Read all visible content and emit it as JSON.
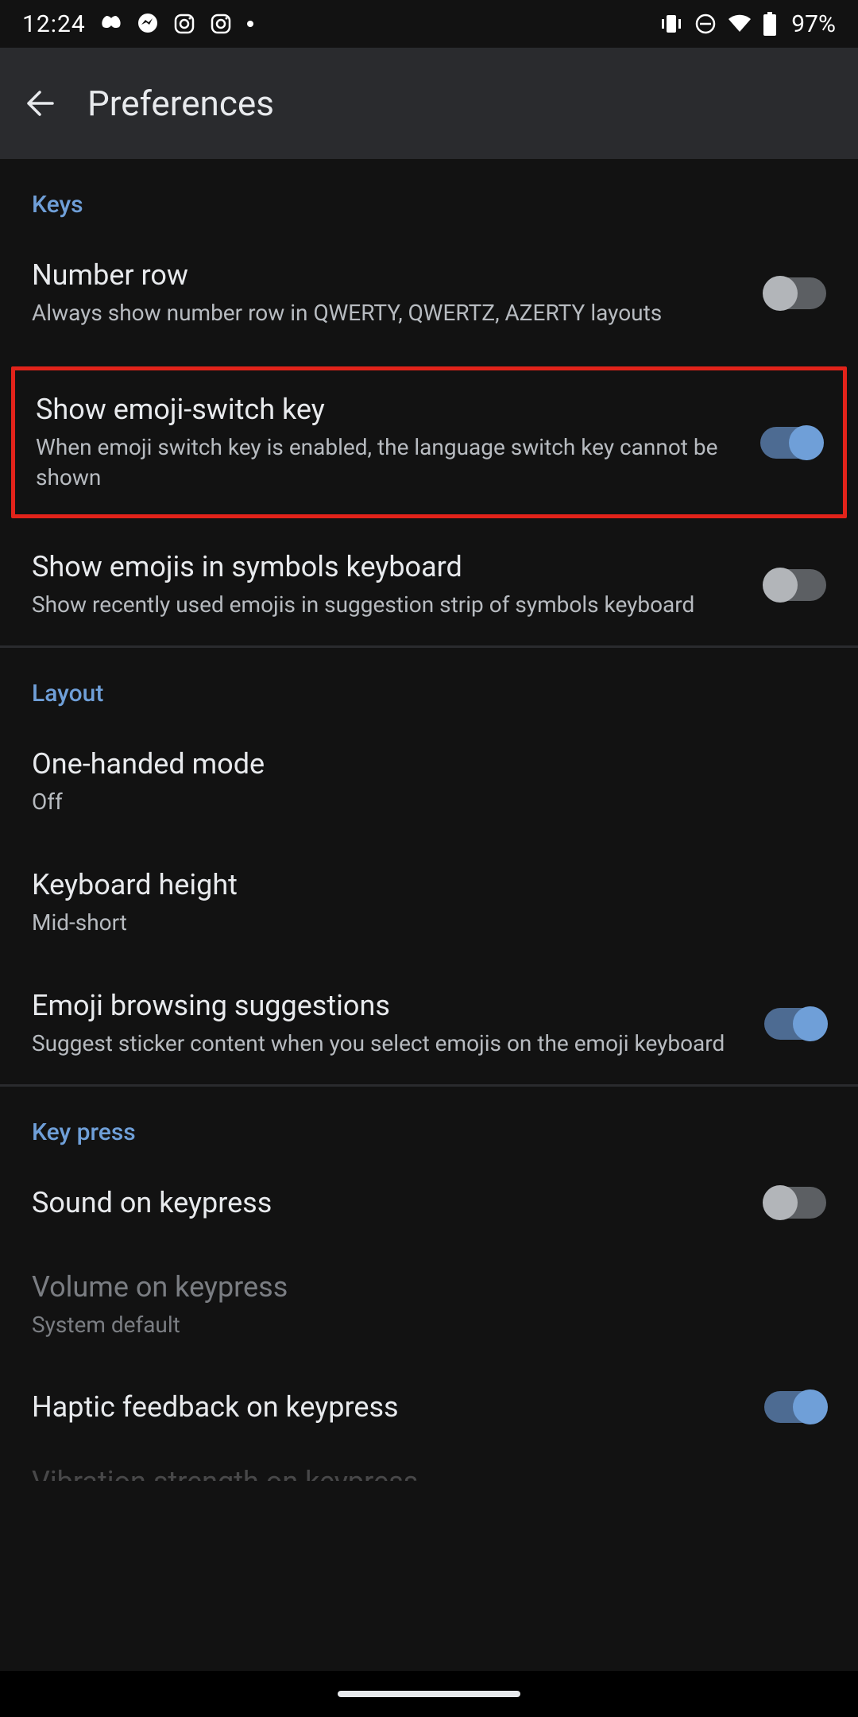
{
  "status": {
    "clock": "12:24",
    "battery_pct": "97%"
  },
  "appbar": {
    "title": "Preferences"
  },
  "sections": {
    "keys": {
      "header": "Keys",
      "number_row": {
        "title": "Number row",
        "sub": "Always show number row in QWERTY, QWERTZ, AZERTY layouts"
      },
      "emoji_switch": {
        "title": "Show emoji-switch key",
        "sub": "When emoji switch key is enabled, the language switch key cannot be shown"
      },
      "emojis_symbols": {
        "title": "Show emojis in symbols keyboard",
        "sub": "Show recently used emojis in suggestion strip of symbols keyboard"
      }
    },
    "layout": {
      "header": "Layout",
      "one_handed": {
        "title": "One-handed mode",
        "sub": "Off"
      },
      "kb_height": {
        "title": "Keyboard height",
        "sub": "Mid-short"
      },
      "emoji_browse": {
        "title": "Emoji browsing suggestions",
        "sub": "Suggest sticker content when you select emojis on the emoji keyboard"
      }
    },
    "keypress": {
      "header": "Key press",
      "sound": {
        "title": "Sound on keypress"
      },
      "volume": {
        "title": "Volume on keypress",
        "sub": "System default"
      },
      "haptic": {
        "title": "Haptic feedback on keypress"
      },
      "vibration": {
        "title": "Vibration strength on keypress"
      }
    }
  }
}
